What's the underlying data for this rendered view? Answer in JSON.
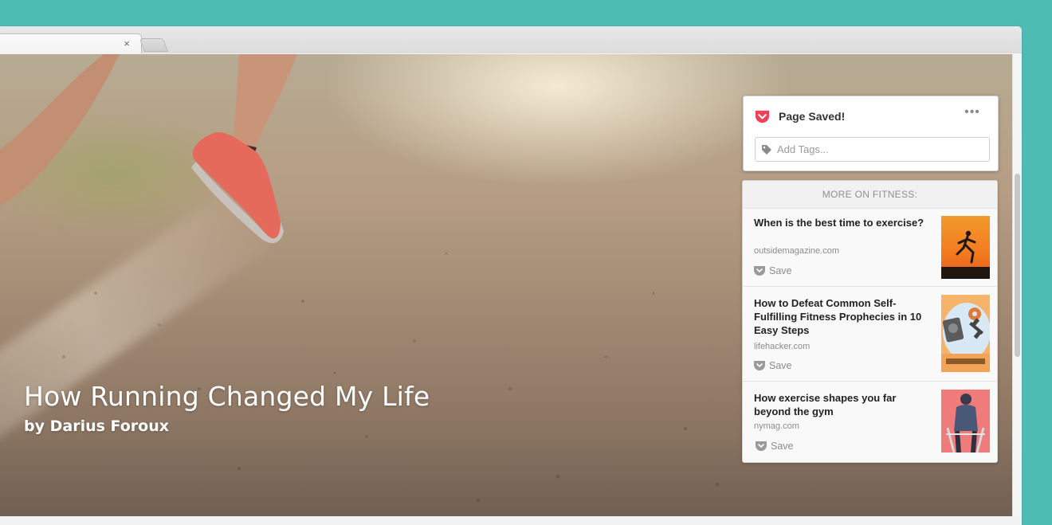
{
  "browser": {
    "tab_close_glyph": "×",
    "toolbar_icons": [
      "cast-icon",
      "pocket-icon",
      "menu-icon"
    ]
  },
  "article": {
    "title": "How Running Changed My Life",
    "author": "by Darius Foroux"
  },
  "pocket_popup": {
    "status": "Page Saved!",
    "more_glyph": "•••",
    "tags_placeholder": "Add Tags...",
    "brand_color": "#ef4056"
  },
  "recommendations": {
    "header": "MORE ON FITNESS:",
    "items": [
      {
        "title": "When is the best time to exercise?",
        "source": "outsidemagazine.com",
        "save_label": "Save",
        "thumb": "runner-silhouette-sunset"
      },
      {
        "title": "How to Defeat Common Self-Fulfilling Fitness Prophecies in 10 Easy Steps",
        "source": "lifehacker.com",
        "save_label": "Save",
        "thumb": "scale-dumbbell-donut"
      },
      {
        "title": "How exercise shapes you far beyond the gym",
        "source": "nymag.com",
        "save_label": "Save",
        "thumb": "treadmill-runner"
      }
    ]
  }
}
